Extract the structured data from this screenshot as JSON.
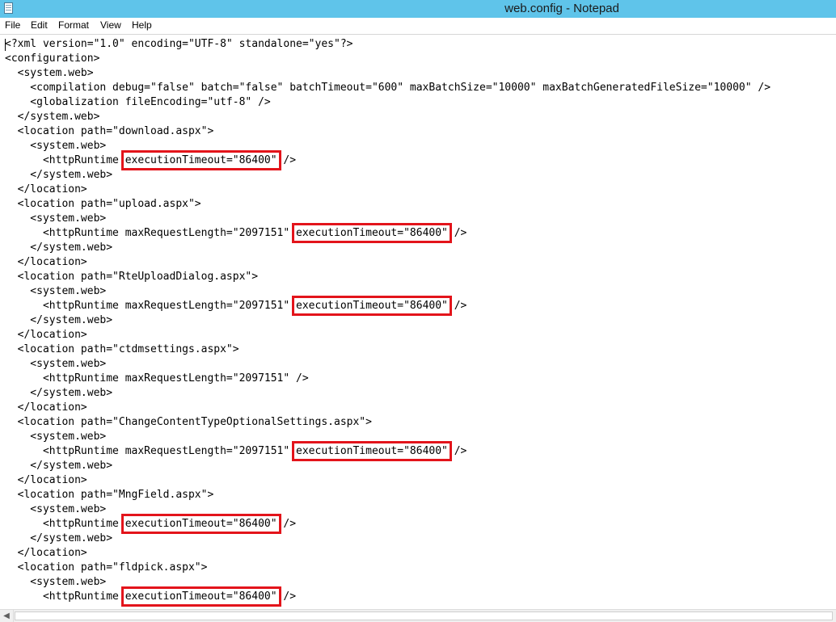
{
  "window": {
    "title": "web.config - Notepad",
    "titlebar_color": "#5fc4ea",
    "highlight_color": "#e3141b",
    "icon": "notepad-icon"
  },
  "menu": [
    "File",
    "Edit",
    "Format",
    "View",
    "Help"
  ],
  "file_lines": [
    {
      "pre": "<?xml version=\"1.0\" encoding=\"UTF-8\" standalone=\"yes\"?>"
    },
    {
      "pre": "<configuration>"
    },
    {
      "pre": "  <system.web>"
    },
    {
      "pre": "    <compilation debug=\"false\" batch=\"false\" batchTimeout=\"600\" maxBatchSize=\"10000\" maxBatchGeneratedFileSize=\"10000\" />"
    },
    {
      "pre": "    <globalization fileEncoding=\"utf-8\" />"
    },
    {
      "pre": "  </system.web>"
    },
    {
      "pre": "  <location path=\"download.aspx\">"
    },
    {
      "pre": "    <system.web>"
    },
    {
      "pre": "      <httpRuntime ",
      "hl": "executionTimeout=\"86400\"",
      "post": " />"
    },
    {
      "pre": "    </system.web>"
    },
    {
      "pre": "  </location>"
    },
    {
      "pre": "  <location path=\"upload.aspx\">"
    },
    {
      "pre": "    <system.web>"
    },
    {
      "pre": "      <httpRuntime maxRequestLength=\"2097151\" ",
      "hl": "executionTimeout=\"86400\"",
      "post": " />"
    },
    {
      "pre": "    </system.web>"
    },
    {
      "pre": "  </location>"
    },
    {
      "pre": "  <location path=\"RteUploadDialog.aspx\">"
    },
    {
      "pre": "    <system.web>"
    },
    {
      "pre": "      <httpRuntime maxRequestLength=\"2097151\" ",
      "hl": "executionTimeout=\"86400\"",
      "post": " />"
    },
    {
      "pre": "    </system.web>"
    },
    {
      "pre": "  </location>"
    },
    {
      "pre": "  <location path=\"ctdmsettings.aspx\">"
    },
    {
      "pre": "    <system.web>"
    },
    {
      "pre": "      <httpRuntime maxRequestLength=\"2097151\" />"
    },
    {
      "pre": "    </system.web>"
    },
    {
      "pre": "  </location>"
    },
    {
      "pre": "  <location path=\"ChangeContentTypeOptionalSettings.aspx\">"
    },
    {
      "pre": "    <system.web>"
    },
    {
      "pre": "      <httpRuntime maxRequestLength=\"2097151\" ",
      "hl": "executionTimeout=\"86400\"",
      "post": " />"
    },
    {
      "pre": "    </system.web>"
    },
    {
      "pre": "  </location>"
    },
    {
      "pre": "  <location path=\"MngField.aspx\">"
    },
    {
      "pre": "    <system.web>"
    },
    {
      "pre": "      <httpRuntime ",
      "hl": "executionTimeout=\"86400\"",
      "post": " />"
    },
    {
      "pre": "    </system.web>"
    },
    {
      "pre": "  </location>"
    },
    {
      "pre": "  <location path=\"fldpick.aspx\">"
    },
    {
      "pre": "    <system.web>"
    },
    {
      "pre": "      <httpRuntime ",
      "hl": "executionTimeout=\"86400\"",
      "post": " />"
    }
  ]
}
